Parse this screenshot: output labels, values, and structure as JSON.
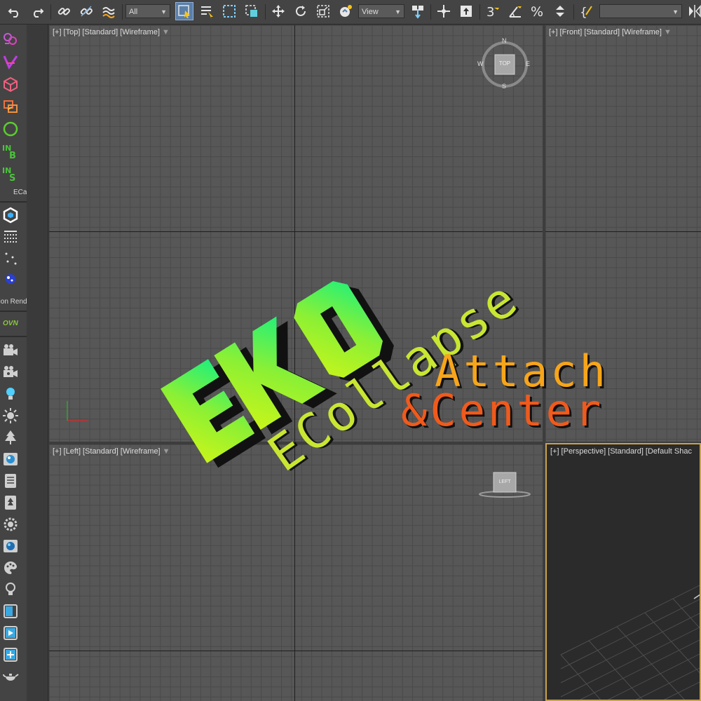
{
  "toolbar": {
    "selection_filter": "All",
    "reference_coord": "View",
    "named_selection": ""
  },
  "left_panel": {
    "ecad_label": "ECad",
    "region_label": "gion Render Pl",
    "ovn_label": "OVN"
  },
  "viewports": {
    "top": {
      "plus": "[+]",
      "view": "[Top]",
      "mode": "[Standard]",
      "shading": "[Wireframe]"
    },
    "front": {
      "plus": "[+]",
      "view": "[Front]",
      "mode": "[Standard]",
      "shading": "[Wireframe]"
    },
    "left": {
      "plus": "[+]",
      "view": "[Left]",
      "mode": "[Standard]",
      "shading": "[Wireframe]"
    },
    "perspective": {
      "plus": "[+]",
      "view": "[Perspective]",
      "mode": "[Standard]",
      "shading": "[Default Shac"
    }
  },
  "viewcube": {
    "top_face": "TOP",
    "left_face": "LEFT",
    "compass": {
      "n": "N",
      "s": "S",
      "e": "E",
      "w": "W"
    }
  },
  "logo": {
    "mark": "EKO",
    "line1": "ECollapse",
    "line2": "Attach",
    "line3": "&Center"
  },
  "colors": {
    "accent_orange": "#f7a51a",
    "accent_red_orange": "#f05a1c",
    "accent_lime": "#c8e632",
    "accent_green": "#21f07a",
    "active_tool": "#5b7fa8",
    "viewport_active_border": "#c9a24a"
  }
}
